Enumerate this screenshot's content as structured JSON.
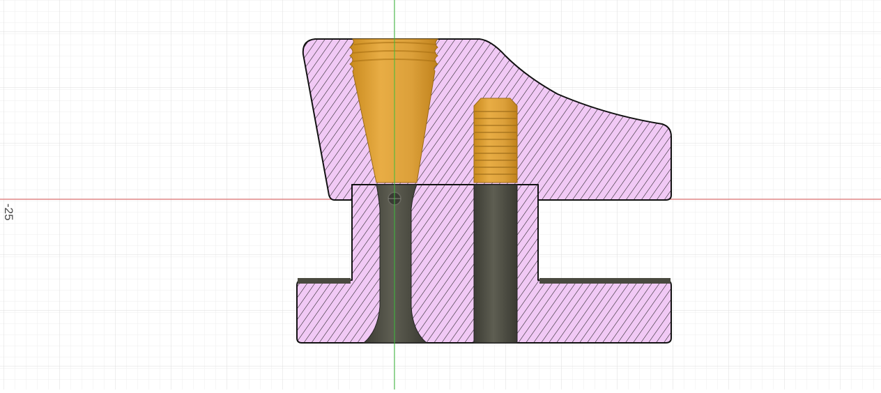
{
  "viewport": {
    "axis_label": "-25"
  },
  "colors": {
    "background": "#ffffff",
    "grid_minor": "#eeeeee",
    "grid_major": "#dcdcdc",
    "axis_red": "#e05a5a",
    "axis_green": "#3cbc3c",
    "section_fill": "#f1c9f5",
    "section_stroke": "#111111",
    "hatch": "#1a1a1a",
    "gold": "#e0a43a",
    "gold_dark": "#c98a1e",
    "dark_body": "#4a4a40",
    "dark_body_light": "#5e5e52"
  }
}
